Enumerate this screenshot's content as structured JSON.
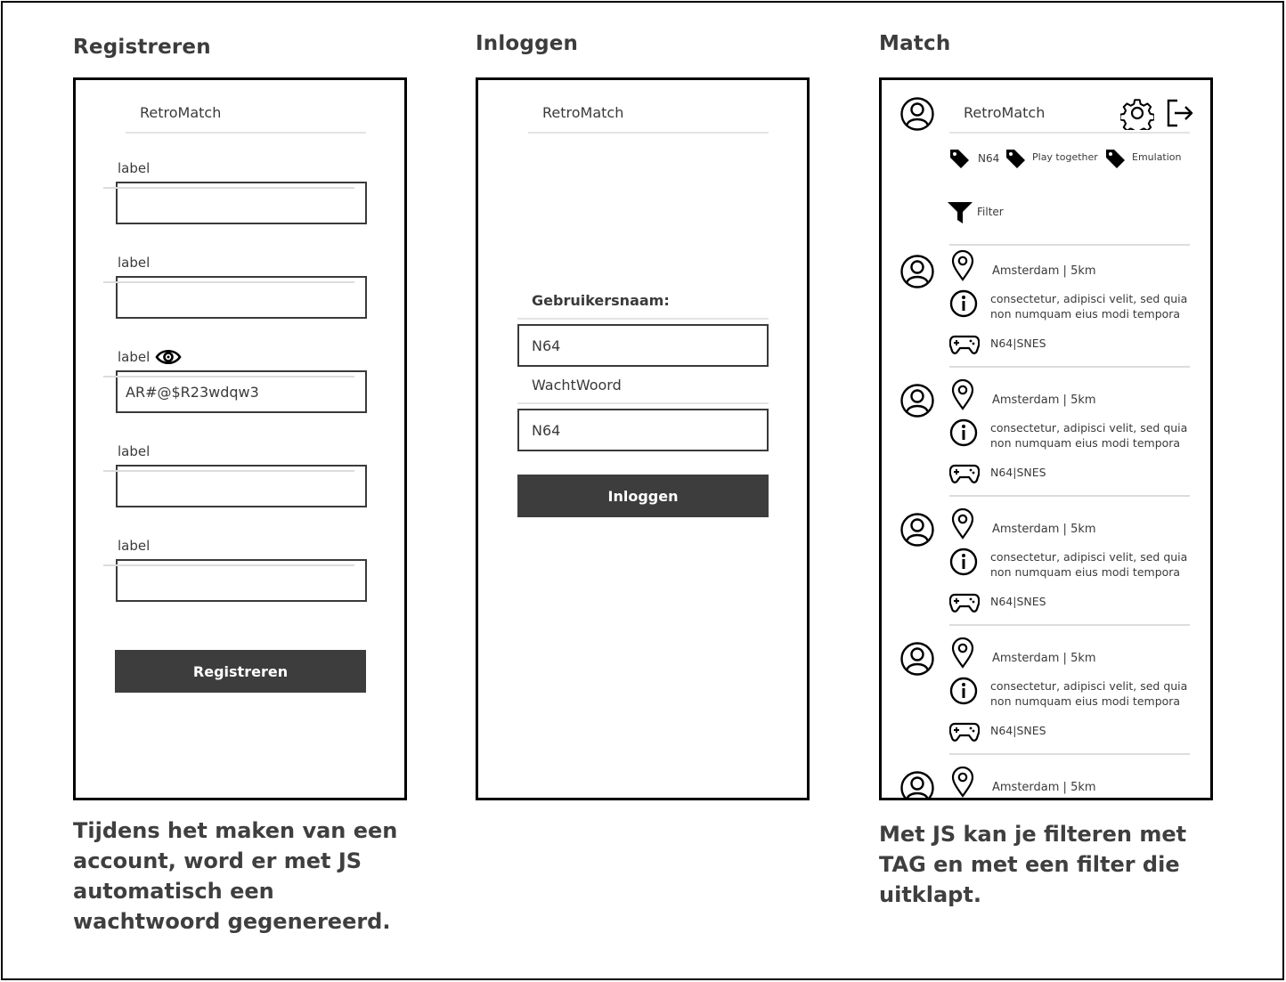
{
  "titles": {
    "register": "Registreren",
    "login": "Inloggen",
    "match": "Match"
  },
  "brand": "RetroMatch",
  "register": {
    "fields": [
      {
        "label": "label",
        "value": ""
      },
      {
        "label": "label",
        "value": ""
      },
      {
        "label": "label",
        "value": "AR#@$R23wdqw3",
        "has_eye": true
      },
      {
        "label": "label",
        "value": ""
      },
      {
        "label": "label",
        "value": ""
      }
    ],
    "button": "Registreren",
    "note": "Tijdens het maken van een account, word er met JS automatisch een wachtwoord gegenereerd."
  },
  "login": {
    "username_label": "Gebruikersnaam:",
    "username_value": "N64",
    "password_label": "WachtWoord",
    "password_value": "N64",
    "button": "Inloggen"
  },
  "match": {
    "tags": [
      "N64",
      "Play together",
      "Emulation"
    ],
    "filter_label": "Filter",
    "cards": [
      {
        "location": "Amsterdam | 5km",
        "description": "consectetur, adipisci velit, sed quia non numquam eius modi tempora",
        "games": "N64|SNES"
      },
      {
        "location": "Amsterdam | 5km",
        "description": "consectetur, adipisci velit, sed quia non numquam eius modi tempora",
        "games": "N64|SNES"
      },
      {
        "location": "Amsterdam | 5km",
        "description": "consectetur, adipisci velit, sed quia non numquam eius modi tempora",
        "games": "N64|SNES"
      },
      {
        "location": "Amsterdam | 5km",
        "description": "consectetur, adipisci velit, sed quia non numquam eius modi tempora",
        "games": "N64|SNES"
      },
      {
        "location": "Amsterdam | 5km",
        "description": "",
        "games": ""
      }
    ],
    "note": "Met JS kan je filteren met TAG en met een filter die uitklapt."
  }
}
